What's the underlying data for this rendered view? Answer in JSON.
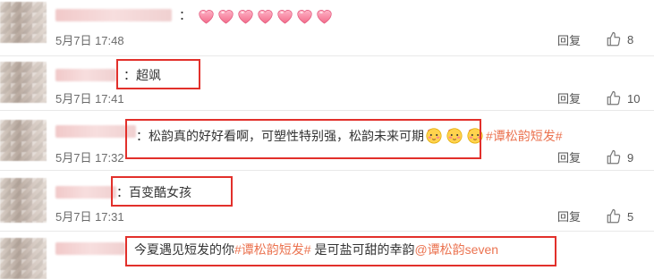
{
  "comments": [
    {
      "text_prefix": "：",
      "time": "5月7日 17:48",
      "reply_label": "回复",
      "likes": "8",
      "heart_count": 7
    },
    {
      "text": "：超飒",
      "time": "5月7日 17:41",
      "reply_label": "回复",
      "likes": "10"
    },
    {
      "text": "：松韵真的好好看啊，可塑性特别强，松韵未来可期",
      "hashtag": "#谭松韵短发#",
      "time": "5月7日 17:32",
      "reply_label": "回复",
      "likes": "9"
    },
    {
      "text": "：百变酷女孩",
      "time": "5月7日 17:31",
      "reply_label": "回复",
      "likes": "5"
    },
    {
      "text_a": "今夏遇见短发的你",
      "hashtag": "#谭松韵短发#",
      "text_b": " 是可盐可甜的幸韵",
      "mention": "@谭松韵seven"
    }
  ],
  "colors": {
    "highlight_box": "#e2302b",
    "hashtag": "#eb7350",
    "heart": "#f26b8a"
  },
  "icons": {
    "like": "thumbs-up-icon",
    "heart": "heart-emoji-icon",
    "face": "blushing-face-emoji-icon"
  }
}
